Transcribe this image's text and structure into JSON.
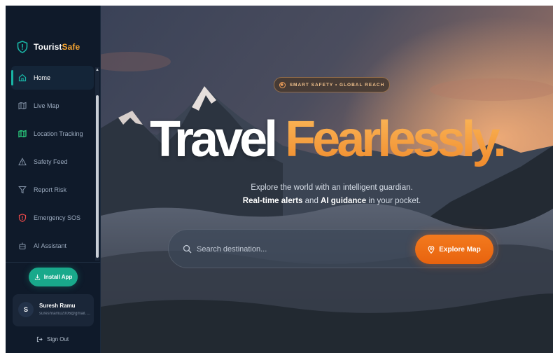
{
  "brand": {
    "name_part1": "Tourist",
    "name_part2": "Safe"
  },
  "sidebar": {
    "items": [
      {
        "label": "Home",
        "icon": "home-icon",
        "active": true
      },
      {
        "label": "Live Map",
        "icon": "map-icon",
        "active": false
      },
      {
        "label": "Location Tracking",
        "icon": "map-fold-icon",
        "active": false
      },
      {
        "label": "Safety Feed",
        "icon": "warning-triangle-icon",
        "active": false
      },
      {
        "label": "Report Risk",
        "icon": "funnel-icon",
        "active": false
      },
      {
        "label": "Emergency SOS",
        "icon": "shield-alert-icon",
        "active": false
      },
      {
        "label": "AI Assistant",
        "icon": "robot-icon",
        "active": false
      }
    ],
    "install_label": "Install App",
    "user": {
      "initial": "S",
      "name": "Suresh Ramu",
      "email": "sureshramu2006@gmail.c..."
    },
    "signout_label": "Sign Out"
  },
  "hero": {
    "badge": "SMART SAFETY • GLOBAL REACH",
    "headline_white": "Travel ",
    "headline_orange": "Fearlessly.",
    "tagline_line1": "Explore the world with an intelligent guardian.",
    "tagline_em1": "Real-time alerts",
    "tagline_mid": " and ",
    "tagline_em2": "AI guidance",
    "tagline_end": " in your pocket.",
    "search_placeholder": "Search destination...",
    "explore_label": "Explore Map"
  },
  "colors": {
    "accent_teal": "#19a98b",
    "accent_orange": "#f0741a",
    "sidebar_bg": "#0f1a2a"
  }
}
